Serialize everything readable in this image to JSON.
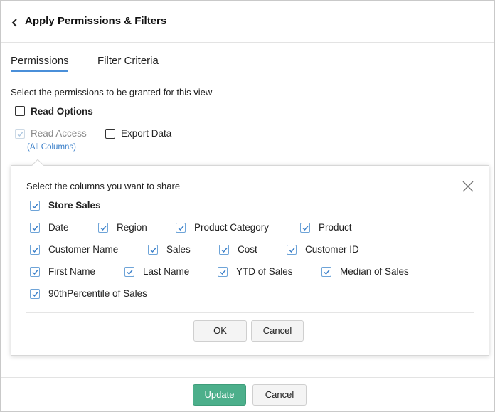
{
  "header": {
    "title": "Apply Permissions & Filters",
    "back_icon": "chevron-left-icon"
  },
  "tabs": [
    {
      "label": "Permissions",
      "active": true
    },
    {
      "label": "Filter Criteria",
      "active": false
    }
  ],
  "permissions": {
    "instruction": "Select the permissions to be granted for this view",
    "read_options": {
      "label": "Read Options",
      "checked": false
    },
    "read_access": {
      "label": "Read Access",
      "checked": true,
      "disabled": true
    },
    "export_data": {
      "label": "Export Data",
      "checked": false
    },
    "all_columns_link": "(All Columns)"
  },
  "popup": {
    "title": "Select the columns you want to share",
    "table": {
      "label": "Store Sales",
      "checked": true
    },
    "columns": [
      {
        "label": "Date",
        "checked": true
      },
      {
        "label": "Region",
        "checked": true
      },
      {
        "label": "Product Category",
        "checked": true
      },
      {
        "label": "Product",
        "checked": true
      },
      {
        "label": "Customer Name",
        "checked": true
      },
      {
        "label": "Sales",
        "checked": true
      },
      {
        "label": "Cost",
        "checked": true
      },
      {
        "label": "Customer ID",
        "checked": true
      },
      {
        "label": "First Name",
        "checked": true
      },
      {
        "label": "Last Name",
        "checked": true
      },
      {
        "label": "YTD of Sales",
        "checked": true
      },
      {
        "label": "Median of Sales",
        "checked": true
      },
      {
        "label": "90thPercentile of Sales",
        "checked": true
      }
    ],
    "ok_label": "OK",
    "cancel_label": "Cancel"
  },
  "footer": {
    "update_label": "Update",
    "cancel_label": "Cancel"
  },
  "colors": {
    "accent": "#4a8fd9",
    "update_button": "#4caf8b",
    "link": "#3a7fc9",
    "checkbox_checked": "#6ea4d8"
  }
}
